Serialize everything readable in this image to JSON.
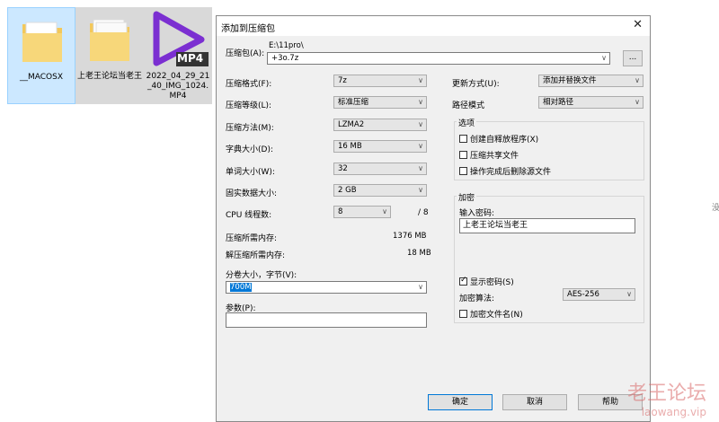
{
  "desktop": {
    "icons": [
      {
        "name": "__MACOSX"
      },
      {
        "name": "上老王论坛当老王"
      },
      {
        "name": "2022_04_29_21_40_IMG_1024.MP4",
        "badge": "MP4"
      }
    ],
    "edge_text": "没"
  },
  "dialog": {
    "title": "添加到压缩包",
    "close": "✕",
    "archive": {
      "label": "压缩包(A):",
      "path": "E:\\11pro\\",
      "name": "+3o.7z",
      "browse": "..."
    },
    "left": {
      "format": {
        "label": "压缩格式(F):",
        "value": "7z"
      },
      "level": {
        "label": "压缩等级(L):",
        "value": "标准压缩"
      },
      "method": {
        "label": "压缩方法(M):",
        "value": "LZMA2"
      },
      "dict": {
        "label": "字典大小(D):",
        "value": "16 MB"
      },
      "word": {
        "label": "单词大小(W):",
        "value": "32"
      },
      "solid": {
        "label": "固实数据大小:",
        "value": "2 GB"
      },
      "cpu": {
        "label": "CPU 线程数:",
        "value": "8",
        "total": "/ 8"
      },
      "mem_comp": {
        "label": "压缩所需内存:",
        "value": "1376 MB"
      },
      "mem_decomp": {
        "label": "解压缩所需内存:",
        "value": "18 MB"
      },
      "volume": {
        "label": "分卷大小，字节(V):",
        "value": "700M"
      },
      "params": {
        "label": "参数(P):",
        "value": ""
      }
    },
    "right": {
      "update": {
        "label": "更新方式(U):",
        "value": "添加并替换文件"
      },
      "path": {
        "label": "路径模式",
        "value": "相对路径"
      },
      "options": {
        "title": "选项",
        "sfx": "创建自释放程序(X)",
        "shared": "压缩共享文件",
        "delete": "操作完成后删除源文件"
      },
      "encryption": {
        "title": "加密",
        "pwd_label": "输入密码:",
        "pwd_value": "上老王论坛当老王",
        "show": "显示密码(S)",
        "method_label": "加密算法:",
        "method_value": "AES-256",
        "names": "加密文件名(N)"
      }
    },
    "buttons": {
      "ok": "确定",
      "cancel": "取消",
      "help": "帮助"
    }
  },
  "watermark": {
    "line1": "老王论坛",
    "line2": "laowang.vip"
  }
}
